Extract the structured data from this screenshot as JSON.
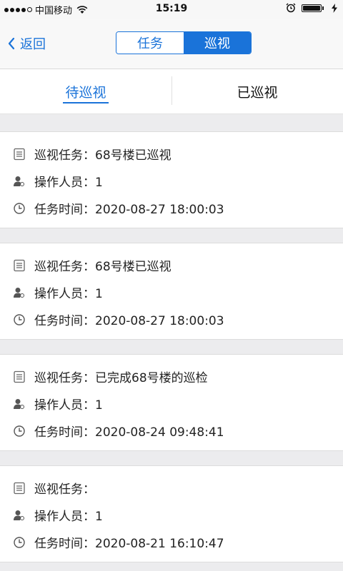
{
  "status_bar": {
    "carrier": "中国移动",
    "time": "15:19",
    "icons": [
      "signal-icon",
      "wifi-icon",
      "alarm-icon",
      "battery-icon",
      "charging-icon"
    ]
  },
  "nav": {
    "back_label": "返回",
    "segments": [
      "任务",
      "巡视"
    ],
    "active_segment": "巡视"
  },
  "tabs": {
    "items": [
      "待巡视",
      "已巡视"
    ],
    "active": "待巡视"
  },
  "labels": {
    "task": "巡视任务：",
    "operator": "操作人员：",
    "time": "任务时间："
  },
  "tasks": [
    {
      "name": "68号楼已巡视",
      "operator": "1",
      "time": "2020-08-27 18:00:03"
    },
    {
      "name": "68号楼已巡视",
      "operator": "1",
      "time": "2020-08-27 18:00:03"
    },
    {
      "name": "已完成68号楼的巡检",
      "operator": "1",
      "time": "2020-08-24 09:48:41"
    },
    {
      "name": "",
      "operator": "1",
      "time": "2020-08-21 16:10:47"
    }
  ],
  "colors": {
    "accent": "#1a73d9",
    "background": "#ececee",
    "card": "#ffffff"
  }
}
